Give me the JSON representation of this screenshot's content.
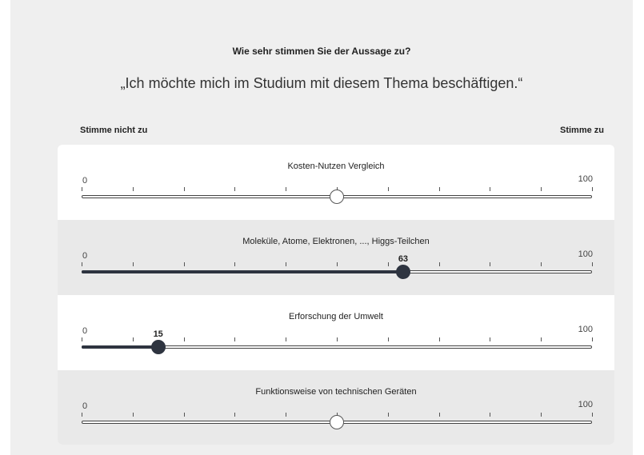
{
  "survey": {
    "question": "Wie sehr stimmen Sie der Aussage zu?",
    "statement": "„Ich möchte mich im Studium mit diesem Thema beschäftigen.“",
    "scale_left_label": "Stimme nicht zu",
    "scale_right_label": "Stimme zu"
  },
  "sliders": [
    {
      "title": "Kosten-Nutzen Vergleich",
      "min": "0",
      "max": "100",
      "value": 50,
      "value_label": "",
      "set": false
    },
    {
      "title": "Moleküle, Atome, Elektronen, ..., Higgs-Teilchen",
      "min": "0",
      "max": "100",
      "value": 63,
      "value_label": "63",
      "set": true
    },
    {
      "title": "Erforschung der Umwelt",
      "min": "0",
      "max": "100",
      "value": 15,
      "value_label": "15",
      "set": true
    },
    {
      "title": "Funktionsweise von technischen Geräten",
      "min": "0",
      "max": "100",
      "value": 50,
      "value_label": "",
      "set": false
    }
  ]
}
